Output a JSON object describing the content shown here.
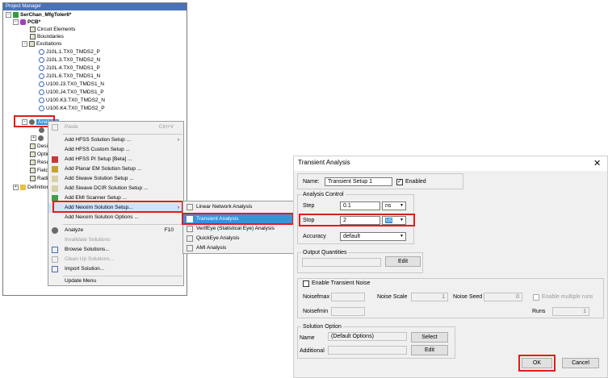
{
  "project_manager": {
    "title": "Project Manager",
    "tree": {
      "project": "SerChan_MfgToler6*",
      "pcb": "PCB*",
      "circuit_elements": "Circuit Elements",
      "boundaries": "Boundaries",
      "excitations": "Excitations",
      "ports": [
        "J10L.1.TX0_TMDS2_P",
        "J10L.3.TX0_TMDS2_N",
        "J10L.4.TX0_TMDS1_P",
        "J10L.6.TX0_TMDS1_N",
        "U100.J3.TX0_TMDS1_N",
        "U100.J4.TX0_TMDS1_P",
        "U100.K3.TX0_TMDS2_N",
        "U100.K4.TX0_TMDS2_P"
      ],
      "analysis": "Analysis",
      "items_partial": [
        "Desig",
        "Optin",
        "Resu",
        "Field",
        "Radi"
      ],
      "definitions": "Definitions"
    }
  },
  "context_menu": {
    "items": [
      {
        "label": "Paste",
        "shortcut": "Ctrl+V",
        "disabled": true,
        "icon": "paste-icon"
      },
      {
        "label": "Add HFSS Solution Setup ...",
        "arrow": true
      },
      {
        "label": "Add HFSS Custom Setup ..."
      },
      {
        "label": "Add HFSS PI Setup [Beta] ...",
        "icon": "hfss-pi-icon"
      },
      {
        "label": "Add Planar EM Solution Setup ...",
        "icon": "planar-em-icon"
      },
      {
        "label": "Add Siwave Solution Setup ...",
        "icon": "siwave-icon"
      },
      {
        "label": "Add Siwave DCIR Solution Setup ...",
        "icon": "siwave-dcir-icon"
      },
      {
        "label": "Add EMI Scanner Setup ...",
        "icon": "emi-icon"
      },
      {
        "label": "Add Nexxim Solution Setup...",
        "arrow": true,
        "highlight": true
      },
      {
        "label": "Add Nexxim Solution Options ..."
      },
      {
        "label": "Analyze",
        "shortcut": "F10",
        "icon": "analyze-icon"
      },
      {
        "label": "Invalidate Solutions",
        "disabled": true
      },
      {
        "label": "Browse Solutions...",
        "icon": "browse-icon"
      },
      {
        "label": "Clean Up Solutions...",
        "disabled": true,
        "icon": "cleanup-icon"
      },
      {
        "label": "Import Solution...",
        "icon": "import-icon"
      },
      {
        "label": "Update Menu"
      }
    ]
  },
  "submenu": {
    "items": [
      {
        "label": "Linear Network Analysis"
      },
      {
        "label": "Transient Analysis",
        "selected": true
      },
      {
        "label": "VerifEye (Statistical Eye) Analysis"
      },
      {
        "label": "QuickEye Analysis"
      },
      {
        "label": "AMI Analysis"
      }
    ]
  },
  "dialog": {
    "title": "Transient Analysis",
    "close": "✕",
    "name_label": "Name:",
    "name_value": "Transient Setup 1",
    "enabled_label": "Enabled",
    "analysis_control": {
      "label": "Analysis Control",
      "step_label": "Step",
      "step_value": "0.1",
      "step_unit": "ns",
      "stop_label": "Stop",
      "stop_value": "2",
      "stop_unit": "us",
      "accuracy_label": "Accuracy",
      "accuracy_value": "default"
    },
    "output_quantities": {
      "label": "Output Quantities",
      "edit": "Edit"
    },
    "transient_noise": {
      "label": "Enable Transient Noise",
      "noisefmax": "Noisefmax",
      "noise_scale": "Noise Scale",
      "noise_scale_value": "1",
      "noise_seed": "Noise Seed",
      "noise_seed_value": "0",
      "enable_multiple_runs": "Enable multiple runs",
      "noisefmin": "Noisefmin",
      "runs": "Runs",
      "runs_value": "1"
    },
    "solution_option": {
      "label": "Solution Option",
      "name_label": "Name",
      "name_value": "(Default Options)",
      "select": "Select",
      "additional_label": "Additional",
      "edit": "Edit"
    },
    "ok": "OK",
    "cancel": "Cancel"
  },
  "colors": {
    "highlight_red": "#e31b1b",
    "selection_blue": "#3a93d9"
  }
}
